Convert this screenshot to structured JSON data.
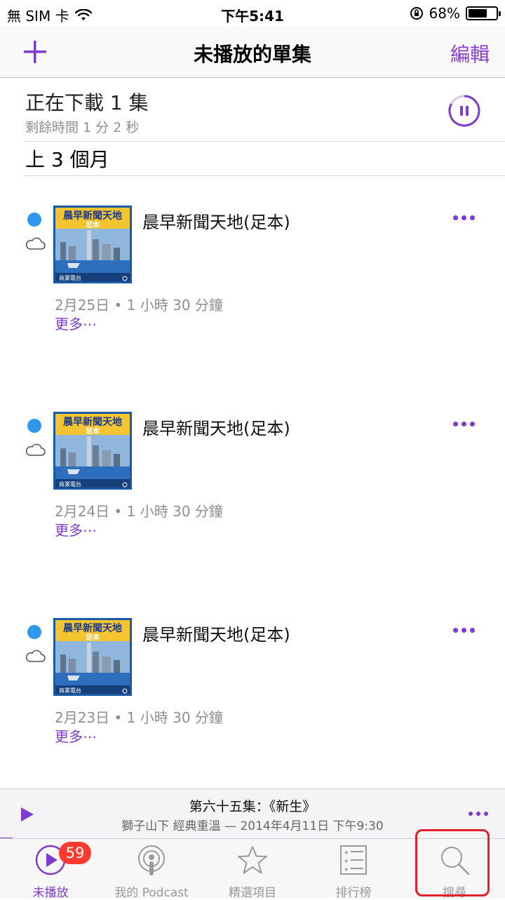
{
  "status_bar": {
    "carrier": "無 SIM 卡",
    "time": "下午5:41",
    "battery_text": "68%",
    "battery_level": 0.68
  },
  "nav": {
    "title": "未播放的單集",
    "edit_label": "編輯",
    "add_icon": "plus-icon"
  },
  "downloading": {
    "title": "正在下載 1 集",
    "remaining": "剩餘時間 1 分 2 秒"
  },
  "section_header": "上 3 個月",
  "episodes": [
    {
      "title": "晨早新聞天地(足本)",
      "meta": "2月25日 • 1 小時 30 分鐘",
      "more": "更多⋯",
      "art_title": "晨早新聞天地",
      "art_sub": "足本",
      "art_logo": "商業電台"
    },
    {
      "title": "晨早新聞天地(足本)",
      "meta": "2月24日 • 1 小時 30 分鐘",
      "more": "更多⋯",
      "art_title": "晨早新聞天地",
      "art_sub": "足本",
      "art_logo": "商業電台"
    },
    {
      "title": "晨早新聞天地(足本)",
      "meta": "2月23日 • 1 小時 30 分鐘",
      "more": "更多⋯",
      "art_title": "晨早新聞天地",
      "art_sub": "足本",
      "art_logo": "商業電台"
    }
  ],
  "mini_player": {
    "title": "第六十五集：《新生》",
    "subtitle": "獅子山下  經典重溫 — 2014年4月11日 下午9:30"
  },
  "tabs": [
    {
      "label": "未播放",
      "icon": "play-circle-icon",
      "badge": "59",
      "active": true
    },
    {
      "label": "我的 Podcast",
      "icon": "podcast-icon",
      "active": false
    },
    {
      "label": "精選項目",
      "icon": "star-icon",
      "active": false
    },
    {
      "label": "排行榜",
      "icon": "list-icon",
      "active": false
    },
    {
      "label": "搜尋",
      "icon": "search-icon",
      "active": false
    }
  ],
  "colors": {
    "accent": "#7d3bd0",
    "unplayed_dot": "#2f97ec",
    "badge": "#ff3b30",
    "highlight": "#e0202a"
  }
}
